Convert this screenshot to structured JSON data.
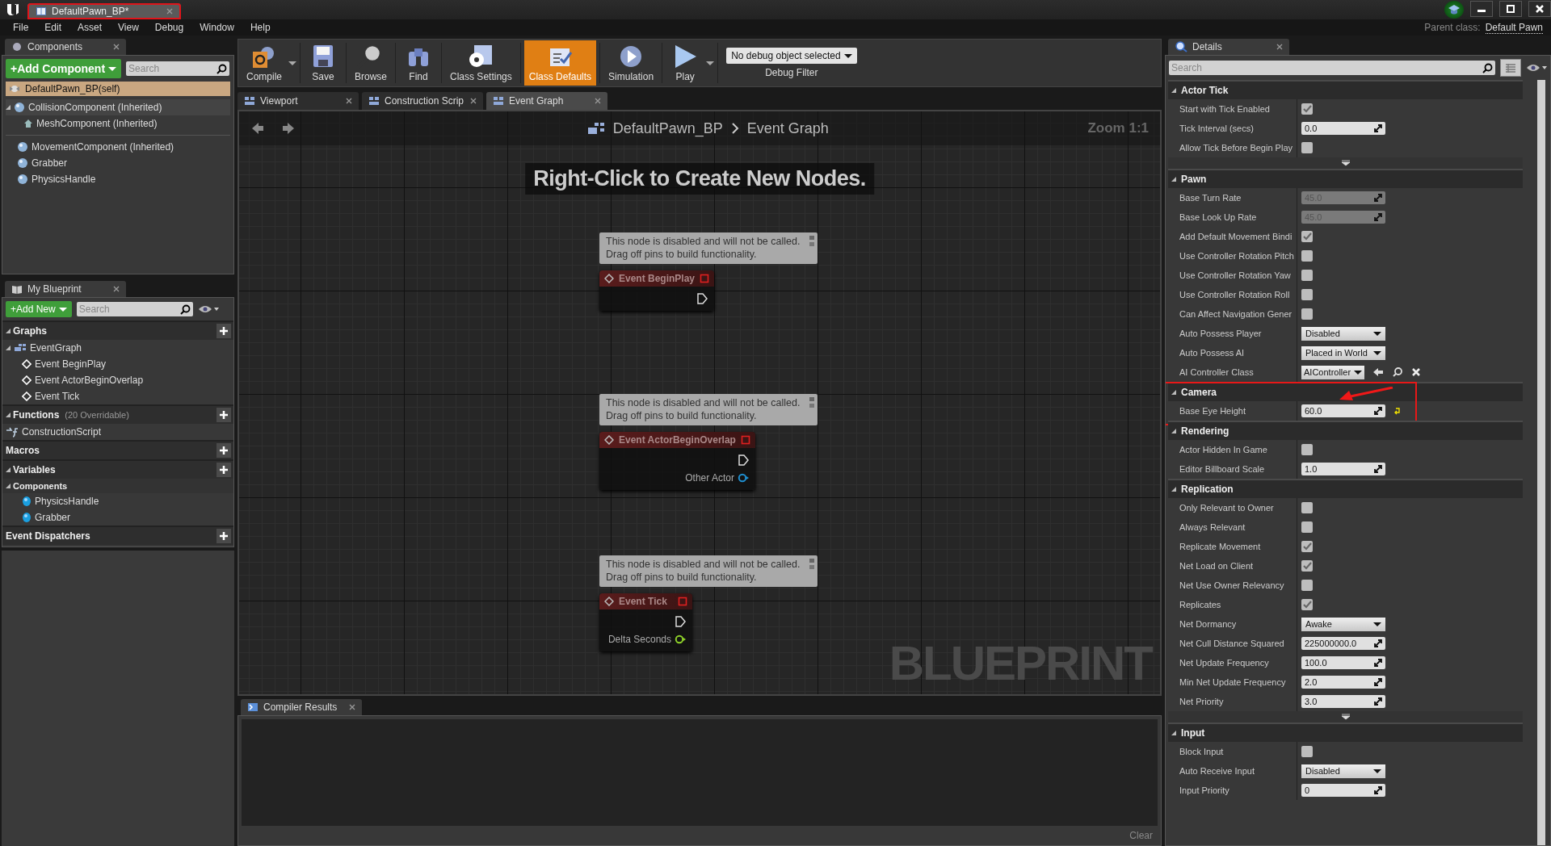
{
  "document_tab": {
    "title": "DefaultPawn_BP*",
    "highlighted": true
  },
  "menu": [
    "File",
    "Edit",
    "Asset",
    "View",
    "Debug",
    "Window",
    "Help"
  ],
  "parent_class": {
    "label": "Parent class:",
    "value": "Default Pawn"
  },
  "components_panel": {
    "tab": "Components",
    "add_button": "+Add Component",
    "search_placeholder": "Search",
    "self_item": {
      "label": "DefaultPawn_BP(self)",
      "selected": true
    },
    "tree": [
      {
        "label": "CollisionComponent (Inherited)",
        "expanded": true,
        "children": [
          {
            "label": "MeshComponent (Inherited)"
          }
        ]
      },
      {
        "label": "MovementComponent (Inherited)"
      },
      {
        "label": "Grabber"
      },
      {
        "label": "PhysicsHandle"
      }
    ]
  },
  "my_blueprint": {
    "tab": "My Blueprint",
    "add_button": "+Add New",
    "search_placeholder": "Search",
    "sections": [
      {
        "title": "Graphs",
        "items": [
          {
            "label": "EventGraph",
            "children": [
              {
                "label": "Event BeginPlay"
              },
              {
                "label": "Event ActorBeginOverlap"
              },
              {
                "label": "Event Tick"
              }
            ]
          }
        ]
      },
      {
        "title": "Functions",
        "note": "(20 Overridable)",
        "items": [
          {
            "label": "ConstructionScript"
          }
        ]
      },
      {
        "title": "Macros"
      },
      {
        "title": "Variables",
        "groups": [
          {
            "title": "Components",
            "items": [
              {
                "label": "PhysicsHandle"
              },
              {
                "label": "Grabber"
              }
            ]
          }
        ]
      },
      {
        "title": "Event Dispatchers"
      }
    ]
  },
  "toolbar": [
    {
      "label": "Compile",
      "selected": false,
      "dropdown": true
    },
    {
      "label": "Save",
      "selected": false,
      "dropdown": false
    },
    {
      "label": "Browse",
      "selected": false,
      "dropdown": false
    },
    {
      "label": "Find",
      "selected": false,
      "dropdown": false
    },
    {
      "label": "Class Settings",
      "selected": false,
      "dropdown": false
    },
    {
      "label": "Class Defaults",
      "selected": true,
      "dropdown": false
    },
    {
      "label": "Simulation",
      "selected": false,
      "dropdown": false
    },
    {
      "label": "Play",
      "selected": false,
      "dropdown": true
    }
  ],
  "debug_filter": {
    "value": "No debug object selected",
    "label": "Debug Filter"
  },
  "editor_tabs": [
    {
      "label": "Viewport",
      "selected": false
    },
    {
      "label": "Construction Scrip",
      "selected": false
    },
    {
      "label": "Event Graph",
      "selected": true
    }
  ],
  "graph": {
    "breadcrumb": [
      "DefaultPawn_BP",
      "Event Graph"
    ],
    "zoom": "Zoom 1:1",
    "hint": "Right-Click to Create New Nodes.",
    "watermark": "BLUEPRINT",
    "nodes": [
      {
        "title": "Event BeginPlay",
        "comment": [
          "This node is disabled and will not be called.",
          "Drag off pins to build functionality."
        ]
      },
      {
        "title": "Event ActorBeginOverlap",
        "comment": [
          "This node is disabled and will not be called.",
          "Drag off pins to build functionality."
        ],
        "pins": [
          {
            "label": "Other Actor",
            "color": "#1f8fd0"
          }
        ]
      },
      {
        "title": "Event Tick",
        "comment": [
          "This node is disabled and will not be called.",
          "Drag off pins to build functionality."
        ],
        "pins": [
          {
            "label": "Delta Seconds",
            "color": "#8ed12a"
          }
        ]
      }
    ]
  },
  "compiler_results": {
    "tab": "Compiler Results",
    "clear_button": "Clear"
  },
  "details": {
    "tab": "Details",
    "search_placeholder": "Search",
    "sections": [
      {
        "title": "Actor Tick",
        "advanced": true,
        "rows": [
          {
            "label": "Start with Tick Enabled",
            "kind": "checkbox",
            "checked": true
          },
          {
            "label": "Tick Interval (secs)",
            "kind": "number",
            "value": "0.0",
            "disabled": false
          },
          {
            "label": "Allow Tick Before Begin Play",
            "kind": "checkbox",
            "checked": false
          }
        ]
      },
      {
        "title": "Pawn",
        "rows": [
          {
            "label": "Base Turn Rate",
            "kind": "number",
            "value": "45.0",
            "disabled": true
          },
          {
            "label": "Base Look Up Rate",
            "kind": "number",
            "value": "45.0",
            "disabled": true
          },
          {
            "label": "Add Default Movement Bindi",
            "kind": "checkbox",
            "checked": true
          },
          {
            "label": "Use Controller Rotation Pitch",
            "kind": "checkbox",
            "checked": false
          },
          {
            "label": "Use Controller Rotation Yaw",
            "kind": "checkbox",
            "checked": false
          },
          {
            "label": "Use Controller Rotation Roll",
            "kind": "checkbox",
            "checked": false
          },
          {
            "label": "Can Affect Navigation Gener",
            "kind": "checkbox",
            "checked": false
          },
          {
            "label": "Auto Possess Player",
            "kind": "dropdown",
            "value": "Disabled"
          },
          {
            "label": "Auto Possess AI",
            "kind": "dropdown",
            "value": "Placed in World"
          },
          {
            "label": "AI Controller Class",
            "kind": "class",
            "value": "AIController"
          }
        ]
      },
      {
        "title": "Camera",
        "highlighted": true,
        "rows": [
          {
            "label": "Base Eye Height",
            "kind": "number",
            "value": "60.0",
            "disabled": false,
            "modified": true,
            "pointed": true
          }
        ]
      },
      {
        "title": "Rendering",
        "rows": [
          {
            "label": "Actor Hidden In Game",
            "kind": "checkbox",
            "checked": false
          },
          {
            "label": "Editor Billboard Scale",
            "kind": "number",
            "value": "1.0",
            "disabled": false
          }
        ]
      },
      {
        "title": "Replication",
        "advanced": true,
        "rows": [
          {
            "label": "Only Relevant to Owner",
            "kind": "checkbox",
            "checked": false
          },
          {
            "label": "Always Relevant",
            "kind": "checkbox",
            "checked": false
          },
          {
            "label": "Replicate Movement",
            "kind": "checkbox",
            "checked": true
          },
          {
            "label": "Net Load on Client",
            "kind": "checkbox",
            "checked": true
          },
          {
            "label": "Net Use Owner Relevancy",
            "kind": "checkbox",
            "checked": false
          },
          {
            "label": "Replicates",
            "kind": "checkbox",
            "checked": true
          },
          {
            "label": "Net Dormancy",
            "kind": "dropdown",
            "value": "Awake"
          },
          {
            "label": "Net Cull Distance Squared",
            "kind": "number",
            "value": "225000000.0",
            "disabled": false
          },
          {
            "label": "Net Update Frequency",
            "kind": "number",
            "value": "100.0",
            "disabled": false
          },
          {
            "label": "Min Net Update Frequency",
            "kind": "number",
            "value": "2.0",
            "disabled": false
          },
          {
            "label": "Net Priority",
            "kind": "number",
            "value": "3.0",
            "disabled": false
          }
        ]
      },
      {
        "title": "Input",
        "rows": [
          {
            "label": "Block Input",
            "kind": "checkbox",
            "checked": false
          },
          {
            "label": "Auto Receive Input",
            "kind": "dropdown",
            "value": "Disabled"
          },
          {
            "label": "Input Priority",
            "kind": "number",
            "value": "0",
            "disabled": false
          }
        ]
      }
    ]
  }
}
